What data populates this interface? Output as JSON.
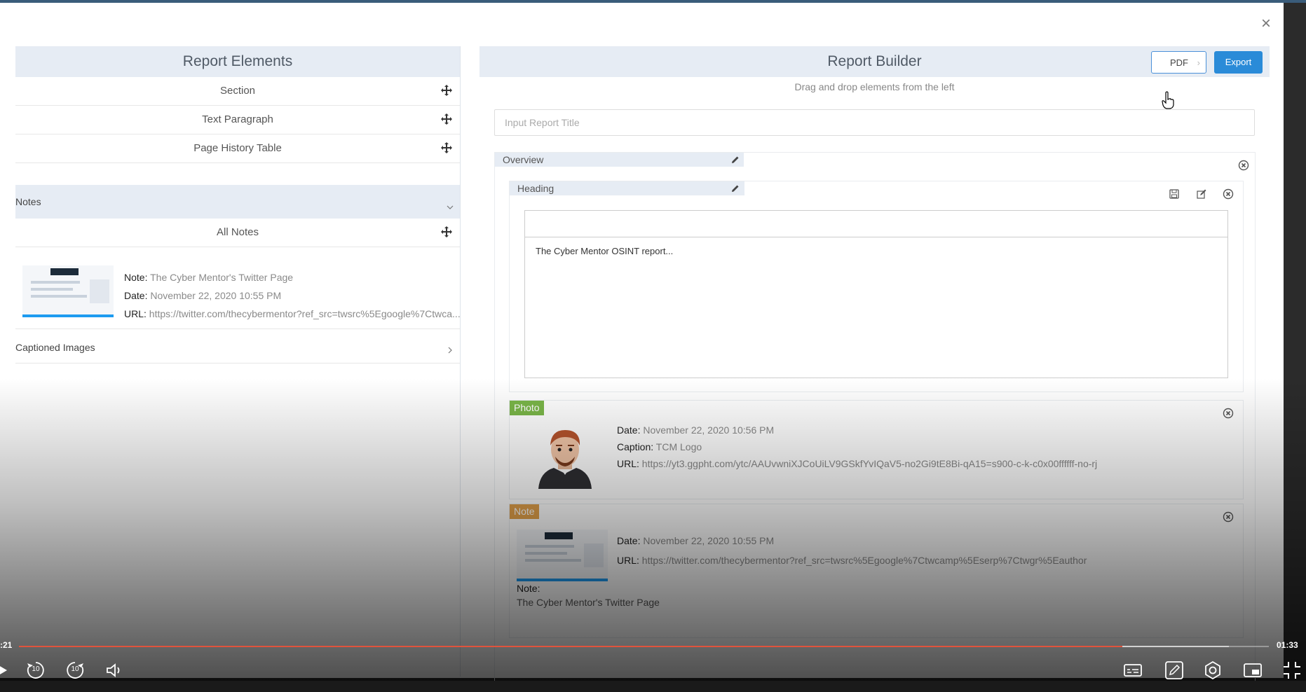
{
  "left_panel": {
    "title": "Report Elements",
    "elements": [
      {
        "label": "Section"
      },
      {
        "label": "Text Paragraph"
      },
      {
        "label": "Page History Table"
      }
    ],
    "notes_header": "Notes",
    "all_notes_label": "All Notes",
    "note_card": {
      "note_key": "Note:",
      "note_value": "The Cyber Mentor's Twitter Page",
      "date_key": "Date:",
      "date_value": "November 22, 2020 10:55 PM",
      "url_key": "URL:",
      "url_value": "https://twitter.com/thecybermentor?ref_src=twsrc%5Egoogle%7Ctwca..."
    },
    "captioned_images_header": "Captioned Images"
  },
  "builder": {
    "title": "Report Builder",
    "pdf_label": "PDF",
    "export_label": "Export",
    "hint": "Drag and drop elements from the left",
    "title_placeholder": "Input Report Title",
    "section_label": "Overview",
    "heading_label": "Heading",
    "editor_text": "The Cyber Mentor OSINT report...",
    "photo": {
      "tag": "Photo",
      "date_key": "Date:",
      "date_value": "November 22, 2020 10:56 PM",
      "caption_key": "Caption:",
      "caption_value": "TCM Logo",
      "url_key": "URL:",
      "url_value": "https://yt3.ggpht.com/ytc/AAUvwniXJCoUiLV9GSkfYvIQaV5-no2Gi9tE8Bi-qA15=s900-c-k-c0x00ffffff-no-rj"
    },
    "note": {
      "tag": "Note",
      "date_key": "Date:",
      "date_value": "November 22, 2020 10:55 PM",
      "url_key": "URL:",
      "url_value": "https://twitter.com/thecybermentor?ref_src=twsrc%5Egoogle%7Ctwcamp%5Eserp%7Ctwgr%5Eauthor",
      "note_key": "Note:",
      "note_value": "The Cyber Mentor's Twitter Page"
    }
  },
  "player": {
    "time_elapsed": ":21",
    "time_remaining": "01:33",
    "skip_back_label": "10",
    "skip_forward_label": "10",
    "progress_fraction": 0.883,
    "buffered_fraction": 0.968,
    "progress_color": "#e0533d"
  }
}
